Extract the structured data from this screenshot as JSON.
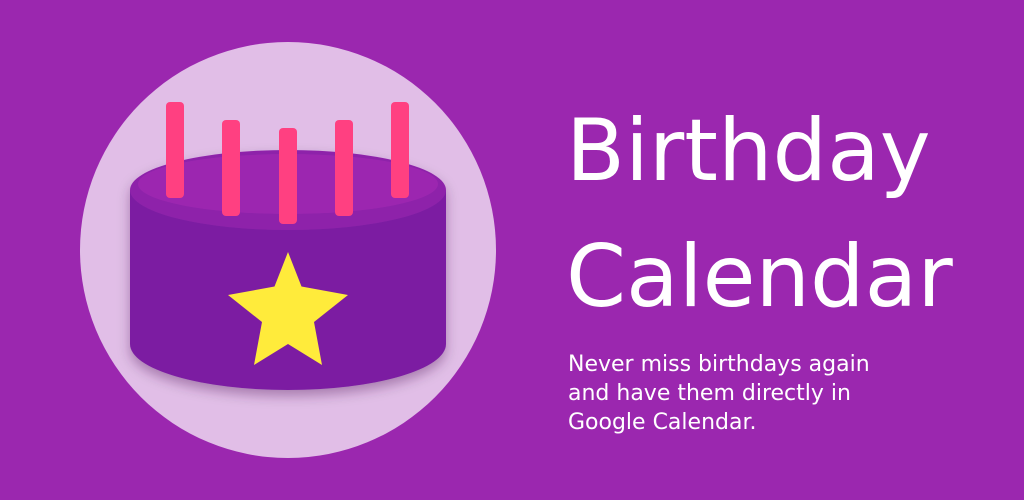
{
  "app": {
    "title_line1": "Birthday",
    "title_line2": "Calendar",
    "tagline_line1": "Never miss birthdays again",
    "tagline_line2": "and have them directly in",
    "tagline_line3": "Google Calendar."
  },
  "icon": {
    "name": "birthday-cake-icon",
    "candle_count": 5
  },
  "colors": {
    "background": "#9b27af",
    "circle": "#e1bee7",
    "cake_body": "#7b1fa2",
    "cake_top": "#9c27b0",
    "candle": "#ff4081",
    "star": "#ffeb3b",
    "text": "#ffffff"
  }
}
